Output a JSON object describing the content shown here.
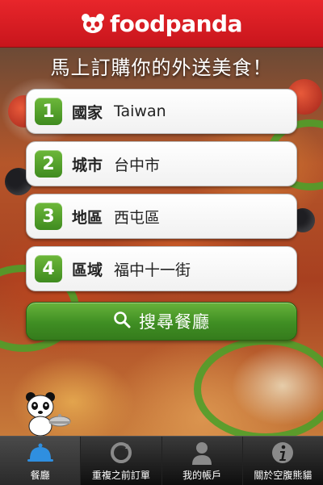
{
  "app": {
    "brand": "foodpanda"
  },
  "headline": "馬上訂購你的外送美食！",
  "steps": [
    {
      "number": "1",
      "label": "國家",
      "value": "Taiwan"
    },
    {
      "number": "2",
      "label": "城市",
      "value": "台中市"
    },
    {
      "number": "3",
      "label": "地區",
      "value": "西屯區"
    },
    {
      "number": "4",
      "label": "區域",
      "value": "福中十一街"
    }
  ],
  "search_button": {
    "label": "搜尋餐廳",
    "icon": "magnifier-icon"
  },
  "tabs": [
    {
      "label": "餐廳",
      "icon": "cloche-icon",
      "active": true
    },
    {
      "label": "重複之前訂單",
      "icon": "refresh-icon",
      "active": false
    },
    {
      "label": "我的帳戶",
      "icon": "person-icon",
      "active": false
    },
    {
      "label": "關於空腹熊貓",
      "icon": "info-icon",
      "active": false
    }
  ],
  "colors": {
    "brand_red": "#d71d23",
    "accent_green": "#4a9a2a",
    "tabbar": "#1a1a1a",
    "active_tab_icon": "#2f8fe0"
  }
}
